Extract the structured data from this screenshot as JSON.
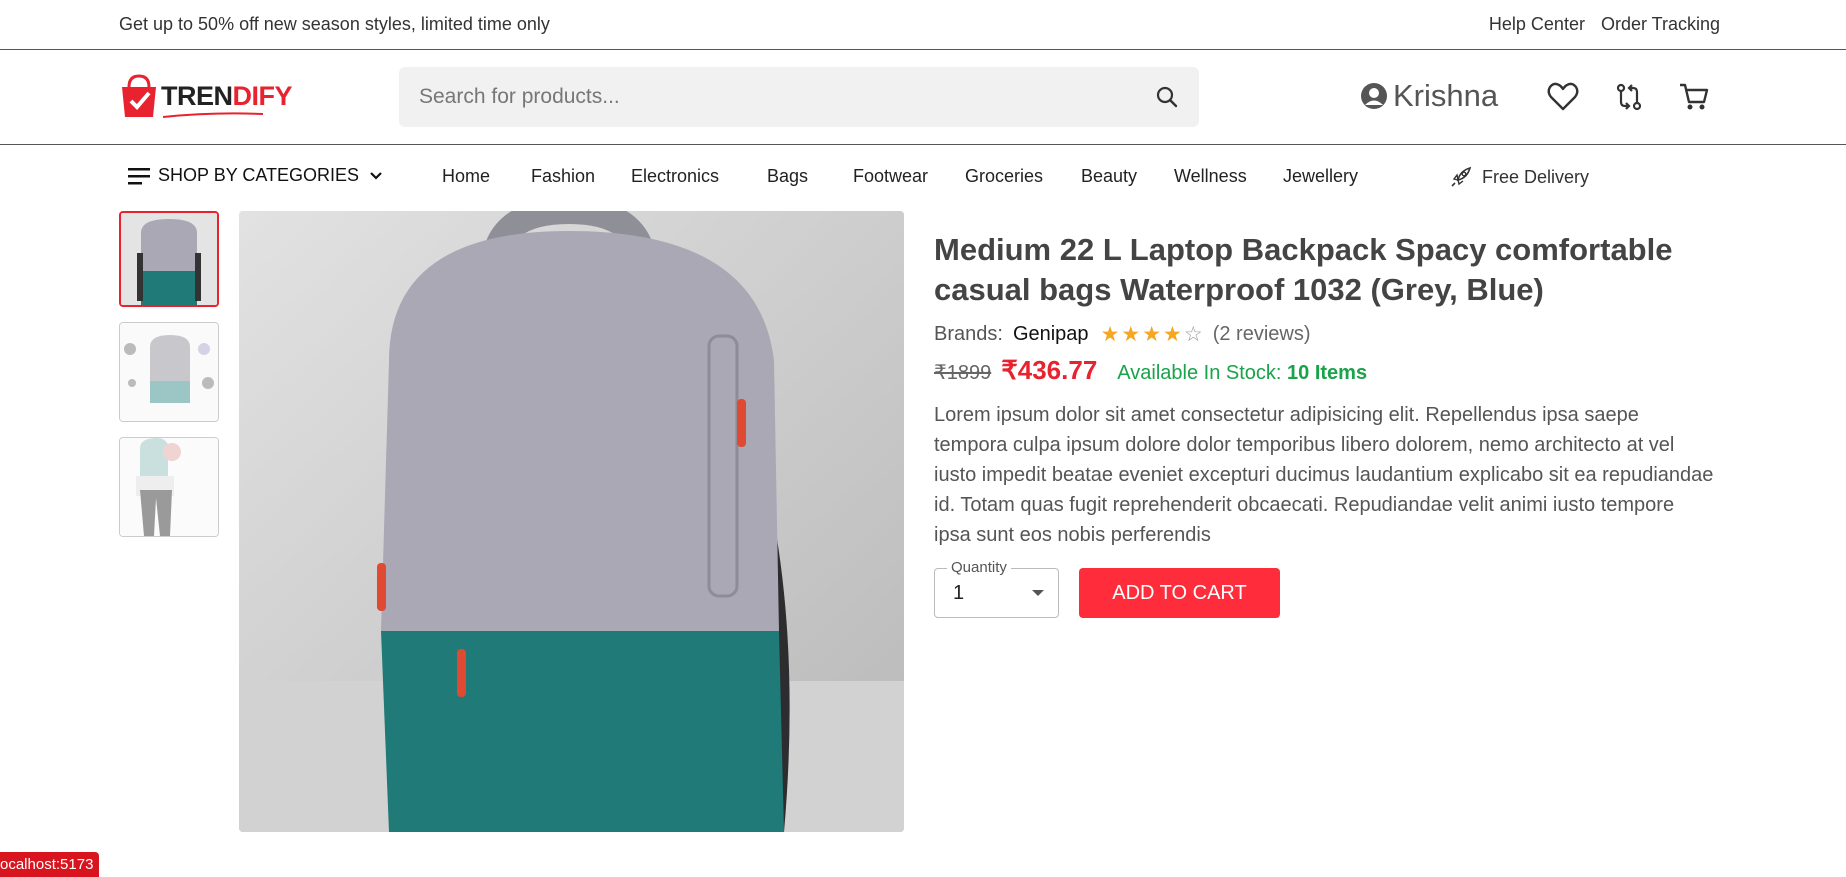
{
  "topbar": {
    "promo": "Get up to 50% off new season styles, limited time only",
    "help_center": "Help Center",
    "order_tracking": "Order Tracking"
  },
  "header": {
    "logo_text_dark": "TREN",
    "logo_text_red": "DIFY",
    "search_placeholder": "Search for products...",
    "user_name": "Krishna",
    "icons": [
      "search-icon",
      "user-icon",
      "heart-icon",
      "compare-icon",
      "cart-icon"
    ]
  },
  "nav": {
    "categories_label": "SHOP BY CATEGORIES",
    "links": [
      "Home",
      "Fashion",
      "Electronics",
      "Bags",
      "Footwear",
      "Groceries",
      "Beauty",
      "Wellness",
      "Jewellery"
    ],
    "delivery": "Free Delivery"
  },
  "product": {
    "title": "Medium 22 L Laptop Backpack Spacy comfortable casual bags Waterproof 1032 (Grey, Blue)",
    "brand_label": "Brands:",
    "brand": "Genipap",
    "rating": 4,
    "rating_max": 5,
    "reviews": "(2 reviews)",
    "old_price": "₹1899",
    "new_price": "₹436.77",
    "stock_label": "Available In Stock:",
    "stock_count": "10 Items",
    "description": "Lorem ipsum dolor sit amet consectetur adipisicing elit. Repellendus ipsa saepe tempora culpa ipsum dolore dolor temporibus libero dolorem, nemo architecto at vel iusto impedit beatae eveniet excepturi ducimus laudantium explicabo sit ea repudiandae id. Totam quas fugit reprehenderit obcaecati. Repudiandae velit animi iusto tempore ipsa sunt eos nobis perferendis",
    "quantity_label": "Quantity",
    "quantity_value": "1",
    "add_to_cart": "ADD TO CART"
  },
  "colors": {
    "accent": "#e8232f",
    "button": "#ff2d3c",
    "stock_green": "#19a34a",
    "star": "#f5a623",
    "bag_grey": "#a9a8b4",
    "bag_teal": "#1f7a78"
  },
  "status_url": "ocalhost:5173"
}
